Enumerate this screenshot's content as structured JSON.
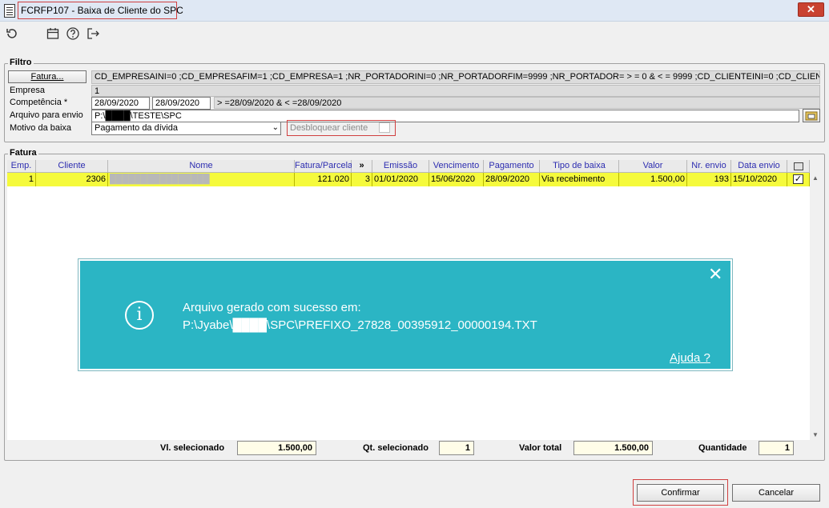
{
  "window": {
    "title": "FCRFP107 - Baixa de Cliente do SPC",
    "close_symbol": "✕"
  },
  "toolbar": {
    "icons": [
      "refresh-icon",
      "calendar-icon",
      "help-icon",
      "exit-icon"
    ]
  },
  "filter": {
    "group_title": "Filtro",
    "fatura_button": "Fatura...",
    "fatura_query": "CD_EMPRESAINI=0 ;CD_EMPRESAFIM=1 ;CD_EMPRESA=1 ;NR_PORTADORINI=0 ;NR_PORTADORFIM=9999 ;NR_PORTADOR= > = 0  & < = 9999 ;CD_CLIENTEINI=0 ;CD_CLIENTEFIM=999999",
    "empresa_label": "Empresa",
    "empresa_value": "1",
    "competencia_label": "Competência *",
    "competencia_start": "28/09/2020",
    "competencia_end": "28/09/2020",
    "competencia_expr": " > =28/09/2020 & < =28/09/2020",
    "arquivo_label": "Arquivo para envio",
    "arquivo_value": "P:\\████\\TESTE\\SPC",
    "motivo_label": "Motivo da baixa",
    "motivo_value": "Pagamento da dívida",
    "desbloquear_label": "Desbloquear cliente"
  },
  "fatura": {
    "group_title": "Fatura",
    "columns": [
      "Emp.",
      "Cliente",
      "Nome",
      "Fatura/Parcela",
      "»",
      "Emissão",
      "Vencimento",
      "Pagamento",
      "Tipo de baixa",
      "Valor",
      "Nr. envio",
      "Data envio"
    ],
    "rows": [
      {
        "emp": "1",
        "cliente": "2306",
        "nome": "████████████████",
        "fatura": "121.020",
        "parcela": "3",
        "emissao": "01/01/2020",
        "vencimento": "15/06/2020",
        "pagamento": "28/09/2020",
        "tipo": "Via recebimento",
        "valor": "1.500,00",
        "nr_envio": "193",
        "data_envio": "15/10/2020",
        "checked": true
      }
    ]
  },
  "totals": {
    "vl_label": "Vl. selecionado",
    "vl_value": "1.500,00",
    "qt_label": "Qt. selecionado",
    "qt_value": "1",
    "total_label": "Valor total",
    "total_value": "1.500,00",
    "qtd_label": "Quantidade",
    "qtd_value": "1"
  },
  "notification": {
    "line1": "Arquivo gerado com sucesso em:",
    "line2": "P:\\Jyabe\\████\\SPC\\PREFIXO_27828_00395912_00000194.TXT",
    "help": "Ajuda ?",
    "close_symbol": "✕",
    "info_symbol": "i"
  },
  "buttons": {
    "confirm": "Confirmar",
    "cancel": "Cancelar"
  },
  "colors": {
    "selected_row": "#f5fa3c",
    "notification_bg": "#2bb5c4",
    "header_text": "#2c2cb0",
    "highlight_outline": "#d04040"
  }
}
